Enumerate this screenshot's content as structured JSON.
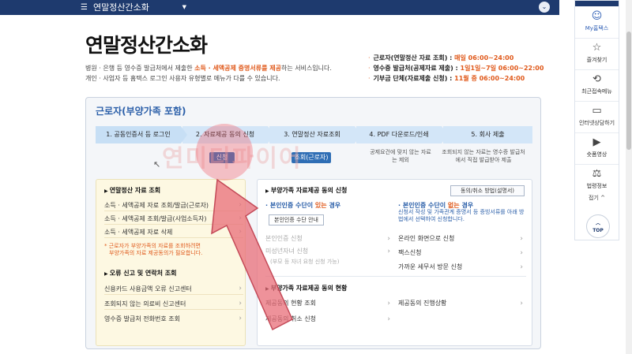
{
  "topbar": {
    "menu_title": "연말정산간소화",
    "menu_icon": "hamburger-icon",
    "expand_icon": "chevron-down-icon"
  },
  "page": {
    "title": "연말정산간소화",
    "intro_line1_a": "병원 · 은행 등 영수증 발급처에서 제출한 ",
    "intro_line1_hl": "소득 · 세액공제 증명서류를 제공",
    "intro_line1_b": "하는 서비스입니다.",
    "intro_line2": "개인 · 사업자 등 홈택스 로그인 사용자 유형별로 메뉴가 다를 수 있습니다."
  },
  "schedule": [
    {
      "label": "근로자(연말정산 자료 조회) : ",
      "time": "매일 06:00~24:00"
    },
    {
      "label": "영수증 발급처(공제자료 제출) : ",
      "time": "1일1일~7일 06:00~22:00"
    },
    {
      "label": "기부금 단체(자료제출 신청) : ",
      "time": "11월 중 06:00~24:00"
    }
  ],
  "panel": {
    "title": "근로자(부양가족 포함)",
    "steps": [
      "1. 공동인증서 등 로그인",
      "2. 자료제공 동의 신청",
      "3. 연말정산 자료조회",
      "4. PDF 다운로드/인쇄",
      "5. 회사 제출"
    ],
    "apply_button": "신청",
    "lookup_button": "조회(근로자)",
    "note_step4": "공제요건에 맞지 않는 자료는 제외",
    "note_step5": "조회되지 않는 자료는 영수증 발급처에서 직접 발급받아 제출"
  },
  "left_box": {
    "section1_title": "연말정산 자료 조회",
    "section1_items": [
      "소득 · 세액공제 자료 조회/발급(근로자)",
      "소득 · 세액공제 조회/발급(사업소득자)",
      "소득 · 세액공제 자료 삭제"
    ],
    "note_line1": "* 근로자가 부양가족의 자료를 조회하려면",
    "note_line2": "부양가족의 자료 제공동의가 필요합니다.",
    "section2_title": "오류 신고 및 연락처 조회",
    "section2_items": [
      "신용카드 사용금액 오류 신고센터",
      "조회되지 않는 의료비 신고센터",
      "영수증 발급처 전화번호 조회"
    ]
  },
  "right_box": {
    "section1_title": "부양가족 자료제공 동의 신청",
    "guide_button": "동의/취소 방법(설명서)",
    "has_auth_a": "본인인증 수단이 ",
    "has_auth_warn": "있는",
    "has_auth_b": " 경우",
    "no_auth_a": "본인인증 수단이 ",
    "no_auth_warn": "없는",
    "no_auth_b": " 경우",
    "auth_guide_button": "본인인증 수단 안내",
    "no_auth_note": "신청서 작성 및 가족관계 증명서 등 증빙서류를 아래 방법에서 선택하여 신청합니다.",
    "left_items": [
      "본인인증 신청",
      "미성년자녀 신청",
      "(부모 등 자녀 요청 신청 가능)"
    ],
    "right_items": [
      "온라인 화면으로 신청",
      "팩스신청",
      "가까운 세무서 방문 신청"
    ],
    "section2_title": "부양가족 자료제공 동의 현황",
    "section2_left": [
      "제공동의 현황 조회",
      "제공동의 취소 신청"
    ],
    "section2_right": [
      "제공동의 진행상황"
    ]
  },
  "sidebar": {
    "items": [
      {
        "label": "My홈택스",
        "icon": "person-icon"
      },
      {
        "label": "즐겨찾기",
        "icon": "star-icon"
      },
      {
        "label": "최근접속메뉴",
        "icon": "history-icon"
      },
      {
        "label": "인터넷상담하기",
        "icon": "monitor-icon"
      },
      {
        "label": "숏폼영상",
        "icon": "play-icon"
      },
      {
        "label": "법령정보",
        "icon": "gavel-icon"
      }
    ],
    "fold_label": "접기 ^",
    "top_label": "TOP"
  },
  "overlay": {
    "watermark": "연미디파이어"
  },
  "colors": {
    "navy": "#1e3a6e",
    "accent_blue": "#2b5fa9",
    "orange": "#e05a1c",
    "highlight_red": "#e85a6a"
  }
}
